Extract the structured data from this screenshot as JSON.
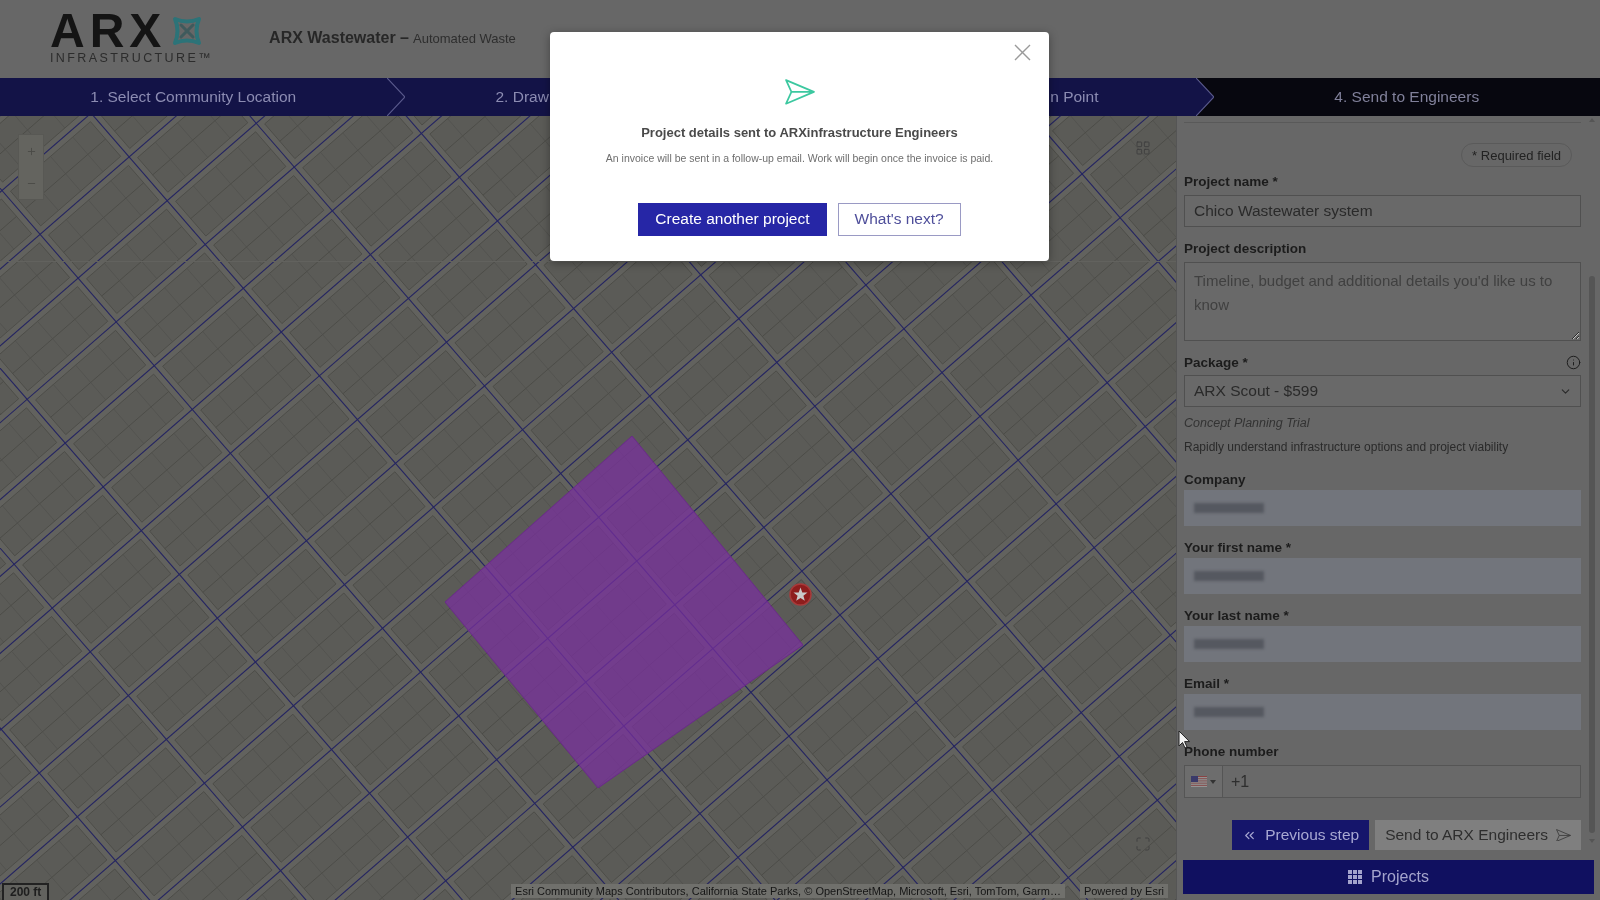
{
  "header": {
    "logo_wordmark": "ARX",
    "logo_tagline": "INFRASTRUCTURE™",
    "title": "ARX Wastewater –",
    "subtitle": "Automated Waste"
  },
  "steps": [
    {
      "label": "1. Select Community Location",
      "selected": false
    },
    {
      "label": "2. Draw",
      "selected": false
    },
    {
      "label": "n Point",
      "selected": false
    },
    {
      "label": "4. Send to Engineers",
      "selected": true
    }
  ],
  "map": {
    "scale": "200 ft",
    "attribution": "Esri Community Maps Contributors, California State Parks, © OpenStreetMap, Microsoft, Esri, TomTom, Garm…",
    "powered_by": "Powered by Esri"
  },
  "form": {
    "required_note": "* Required field",
    "fields": [
      {
        "kind": "text",
        "label": "Project name *",
        "value": "Chico Wastewater system"
      },
      {
        "kind": "textarea",
        "label": "Project description",
        "placeholder": "Timeline, budget and additional details you'd like us to know"
      },
      {
        "kind": "select",
        "label": "Package *",
        "value": "ARX Scout - $599",
        "info": true,
        "plan": "Concept Planning Trial",
        "plan_description": "Rapidly understand infrastructure options and project viability"
      },
      {
        "kind": "redacted",
        "label": "Company"
      },
      {
        "kind": "redacted",
        "label": "Your first name *"
      },
      {
        "kind": "redacted",
        "label": "Your last name *"
      },
      {
        "kind": "redacted",
        "label": "Email *"
      },
      {
        "kind": "phone",
        "label": "Phone number",
        "value": "+1"
      }
    ],
    "buttons": [
      {
        "label": "Previous step",
        "kind": "back",
        "disabled": false
      },
      {
        "label": "Send to ARX Engineers",
        "kind": "send",
        "disabled": true
      }
    ],
    "projects_button": "Projects"
  },
  "dialog": {
    "title": "Project details sent to ARXinfrastructure Engineers",
    "message": "An invoice will be sent in a follow-up email. Work will begin once the invoice is paid.",
    "buttons": [
      {
        "label": "Create another project",
        "kind": "primary"
      },
      {
        "label": "What's next?",
        "kind": "secondary"
      }
    ]
  }
}
